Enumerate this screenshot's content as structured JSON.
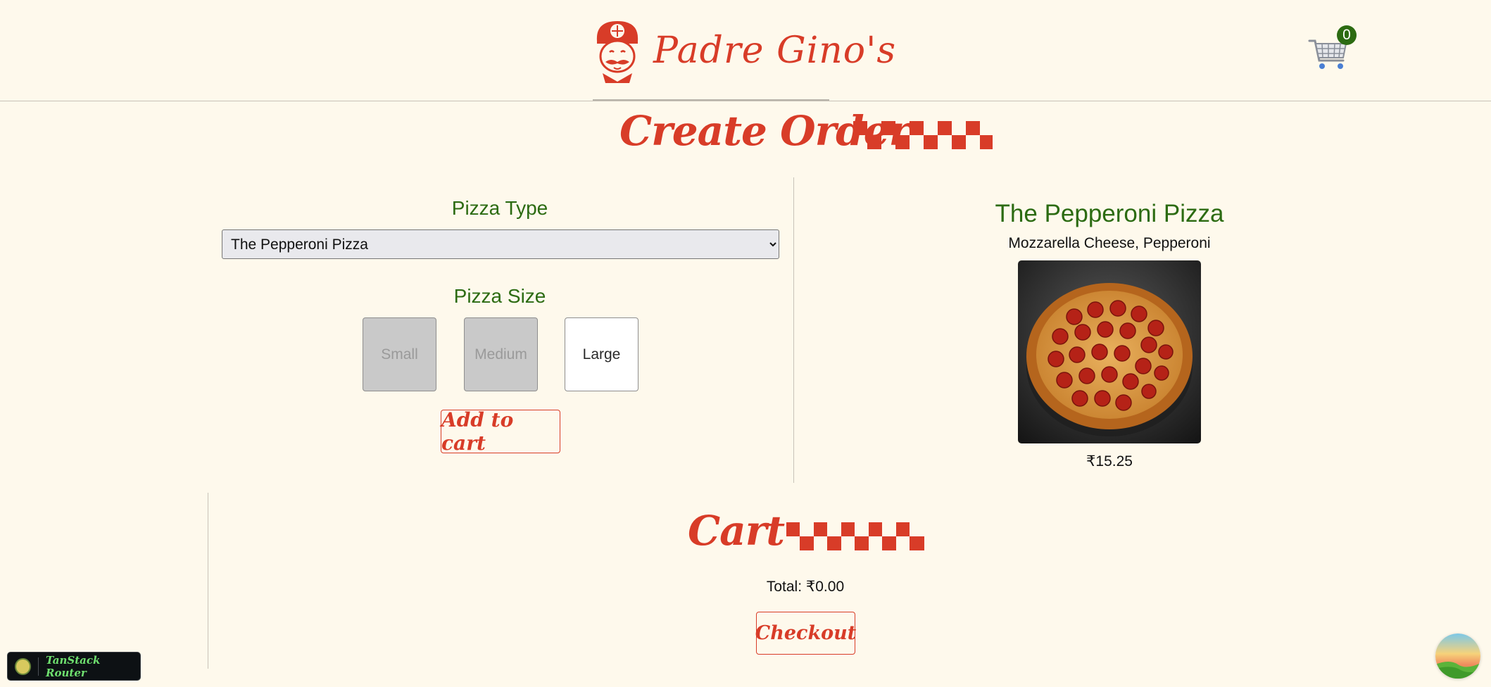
{
  "header": {
    "brand_name": "Padre Gino's",
    "cart_count": "0"
  },
  "order": {
    "title": "Create Order",
    "pizza_type_label": "Pizza Type",
    "selected_pizza": "The Pepperoni Pizza",
    "pizza_size_label": "Pizza Size",
    "sizes": [
      {
        "label": "Small",
        "selected": false
      },
      {
        "label": "Medium",
        "selected": false
      },
      {
        "label": "Large",
        "selected": true
      }
    ],
    "add_to_cart_label": "Add to cart"
  },
  "pizza": {
    "name": "The Pepperoni Pizza",
    "description": "Mozzarella Cheese, Pepperoni",
    "price": "₹15.25"
  },
  "cart": {
    "title": "Cart",
    "total": "Total: ₹0.00",
    "checkout_label": "Checkout"
  },
  "devtools": {
    "label": "TanStack Router"
  },
  "colors": {
    "accent": "#d83c28",
    "green": "#2c6b12",
    "background": "#fef9ec"
  }
}
